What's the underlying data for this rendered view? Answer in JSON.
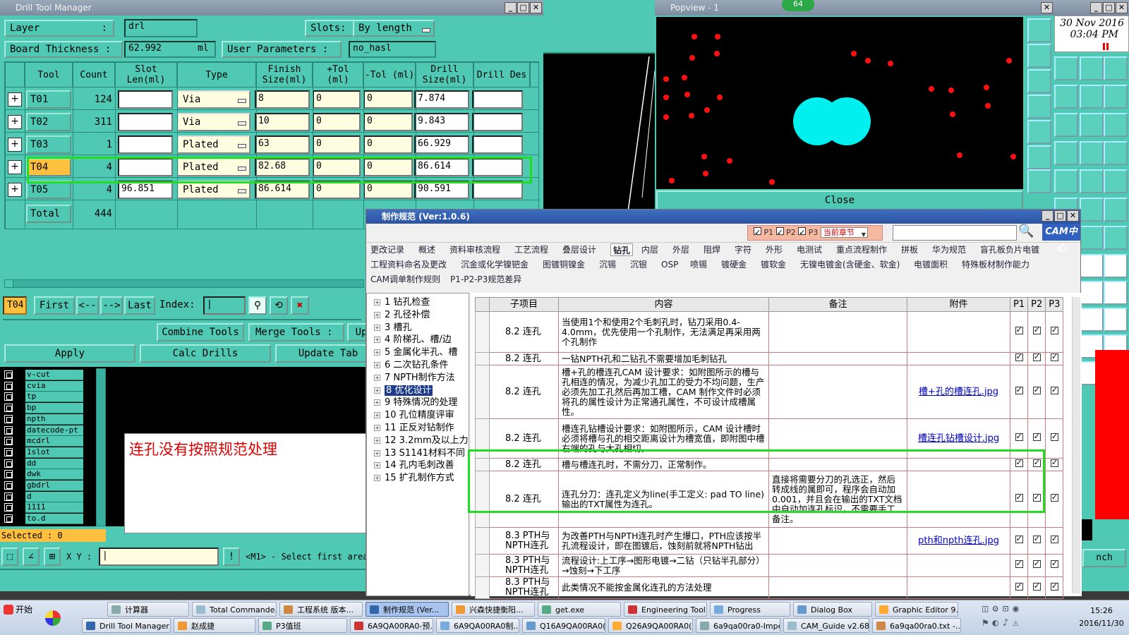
{
  "dtm": {
    "title": "Drill Tool Manager",
    "layer_label": "Layer",
    "layer_colon": ":",
    "layer_value": "drl",
    "slots_label": "Slots:",
    "slots_value": "By length",
    "board_label": "Board Thickness :",
    "board_value": "62.992",
    "board_unit": "ml",
    "user_params_label": "User Parameters :",
    "user_params_value": "no_hasl",
    "headers": [
      "Tool",
      "Count",
      "Slot Len(ml)",
      "Type",
      "Finish Size(ml)",
      "+Tol (ml)",
      "-Tol (ml)",
      "Drill Size(ml)",
      "Drill Des"
    ],
    "rows": [
      {
        "tool": "T01",
        "count": "124",
        "slot": "",
        "type": "Via",
        "finish": "8",
        "ptol": "0",
        "mtol": "0",
        "drill": "7.874",
        "des": ""
      },
      {
        "tool": "T02",
        "count": "311",
        "slot": "",
        "type": "Via",
        "finish": "10",
        "ptol": "0",
        "mtol": "0",
        "drill": "9.843",
        "des": ""
      },
      {
        "tool": "T03",
        "count": "1",
        "slot": "",
        "type": "Plated",
        "finish": "63",
        "ptol": "0",
        "mtol": "0",
        "drill": "66.929",
        "des": ""
      },
      {
        "tool": "T04",
        "count": "4",
        "slot": "",
        "type": "Plated",
        "finish": "82.68",
        "ptol": "0",
        "mtol": "0",
        "drill": "86.614",
        "des": ""
      },
      {
        "tool": "T05",
        "count": "4",
        "slot": "96.851",
        "type": "Plated",
        "finish": "86.614",
        "ptol": "0",
        "mtol": "0",
        "drill": "90.591",
        "des": ""
      }
    ],
    "total_label": "Total",
    "total_count": "444",
    "current_tool": "T04",
    "nav": {
      "first": "First",
      "prev": "<--",
      "next": "-->",
      "last": "Last",
      "index": "Index:"
    },
    "buttons": {
      "combine": "Combine Tools",
      "merge": "Merge Tools :",
      "up": "Up",
      "apply": "Apply",
      "calc": "Calc Drills",
      "update": "Update Tab"
    },
    "layers": [
      "v-cut",
      "cvia",
      "tp",
      "bp",
      "npth",
      "datecode-pt",
      "mcdrl",
      "1slot",
      "dd",
      "dwk",
      "gbdrl",
      "d",
      "1111",
      "to.d"
    ],
    "selected": "Selected : 0",
    "xy_label": "X Y :",
    "status": "<M1> - Select first area"
  },
  "annotation": "连孔没有按照规范处理",
  "popview": {
    "title": "Popview - 1",
    "close": "Close",
    "badge": "64"
  },
  "spec": {
    "title": "制作规范 (Ver:1.0.6)",
    "filter": {
      "p1": "P1",
      "p2": "P2",
      "p3": "P3",
      "scope": "当前章节"
    },
    "logo": "CAM中心",
    "tabs_row1": [
      "更改记录",
      "概述",
      "资料审核流程",
      "工艺流程",
      "叠层设计",
      "钻孔",
      "内层",
      "外层",
      "阻焊",
      "字符",
      "外形",
      "电测试",
      "重点流程制作",
      "拼板",
      "华为规范",
      "盲孔板负片电镀"
    ],
    "tabs_row2": [
      "工程资料命名及更改",
      "沉金或化学镍钯金",
      "图镀铜镍金",
      "沉锡",
      "沉银",
      "OSP",
      "喷锡",
      "镀硬金",
      "镀软金",
      "无镍电镀金(含硬金、软金)",
      "电镀面积",
      "特殊板材制作能力"
    ],
    "tabs_row3": [
      "CAM调单制作规则",
      "P1-P2-P3规范差异"
    ],
    "tree": [
      "1 钻孔检查",
      "2 孔径补偿",
      "3 槽孔",
      "4 阶梯孔、槽/边",
      "5 金属化半孔、槽",
      "6 二次钻孔条件",
      "7 NPTH制作方法",
      "8 优化设计",
      "9 特殊情况的处理",
      "10 孔位精度评审",
      "11 正反对钻制作",
      "12 3.2mm及以上力",
      "13 S1141材料不同",
      "14 孔内毛刺改善",
      "15 扩孔制作方式"
    ],
    "selected_tree": "8 优化设计",
    "table_headers": [
      "子项目",
      "内容",
      "备注",
      "附件",
      "P1",
      "P2",
      "P3"
    ],
    "table_rows": [
      {
        "sub": "8.2 连孔",
        "content": "当使用1个和使用2个毛刺孔时，钻刀采用0.4-4.0mm，优先使用一个孔制作，无法满足再采用两个孔制作",
        "note": "",
        "att": ""
      },
      {
        "sub": "8.2 连孔",
        "content": "一钻NPTH孔和二钻孔不需要增加毛刺钻孔",
        "note": "",
        "att": ""
      },
      {
        "sub": "8.2 连孔",
        "content": "槽+孔的槽连孔CAM 设计要求：如附图所示的槽与孔相连的情况，为减少孔加工的受力不均问题，生产必须先加工孔然后再加工槽，CAM 制作文件时必须将孔的属性设计为正常通孔属性，不可设计成槽属性。",
        "note": "",
        "att": "槽+孔的槽连孔.jpg"
      },
      {
        "sub": "8.2 连孔",
        "content": "槽连孔钻槽设计要求：如附图所示，CAM 设计槽时必须将槽与孔的相交距离设计为槽宽值，即附图中槽右端的孔与大孔相切。",
        "note": "",
        "att": "槽连孔钻槽设计.jpg"
      },
      {
        "sub": "8.2 连孔",
        "content": "槽与槽连孔时，不需分刀，正常制作。",
        "note": "",
        "att": ""
      },
      {
        "sub": "8.2 连孔",
        "content": "连孔分刀：连孔定义为line(手工定义: pad TO line) 输出的TXT属性为连孔。",
        "note": "直接将需要分刀的孔选正，然后转成线的属即可，程序会自动加0.001，并且会在输出的TXT文档中自动加连孔标识，不需要手工备注。",
        "att": ""
      },
      {
        "sub": "8.3 PTH与NPTH连孔",
        "content": "为改善PTH与NPTH连孔时产生爆口，PTH应该按半孔流程设计，即在图镀后，蚀刻前就将NPTH钻出",
        "note": "",
        "att": "pth和npth连孔.jpg"
      },
      {
        "sub": "8.3 PTH与NPTH连孔",
        "content": "流程设计:上工序→图形电镀→二钻（只钻半孔部分）→蚀刻→下工序",
        "note": "",
        "att": ""
      },
      {
        "sub": "8.3 PTH与NPTH连孔",
        "content": "此类情况不能按金属化连孔的方法处理",
        "note": "",
        "att": ""
      }
    ]
  },
  "rightpanel": {
    "date": "30 Nov 2016",
    "time": "03:04 PM",
    "label_right": "nch"
  },
  "taskbar": {
    "start": "开始",
    "row1": [
      "计算器",
      "Total Commande...",
      "工程系统 版本...",
      "制作规范 (Ver...",
      "兴森快捷衡阳...",
      "get.exe",
      "Engineering Tool...",
      "Progress",
      "Dialog Box",
      "Graphic Editor 9...."
    ],
    "row2": [
      "Drill Tool Manager",
      "赵成捷",
      "P3值班",
      "6A9QA00RA0-预...",
      "6A9QA00RA0制...",
      "Q16A9QA00RA0(...",
      "Q26A9QA00RA0(...",
      "6a9qa00ra0-Impe...",
      "CAM_Guide v2.68",
      "6a9qa00ra0.txt -..."
    ],
    "clock_time": "15:26",
    "clock_date": "2016/11/30"
  },
  "colors": {
    "teal": "#4fc8b4",
    "highlight": "#22dd22",
    "selected_tool": "#ffc040"
  }
}
